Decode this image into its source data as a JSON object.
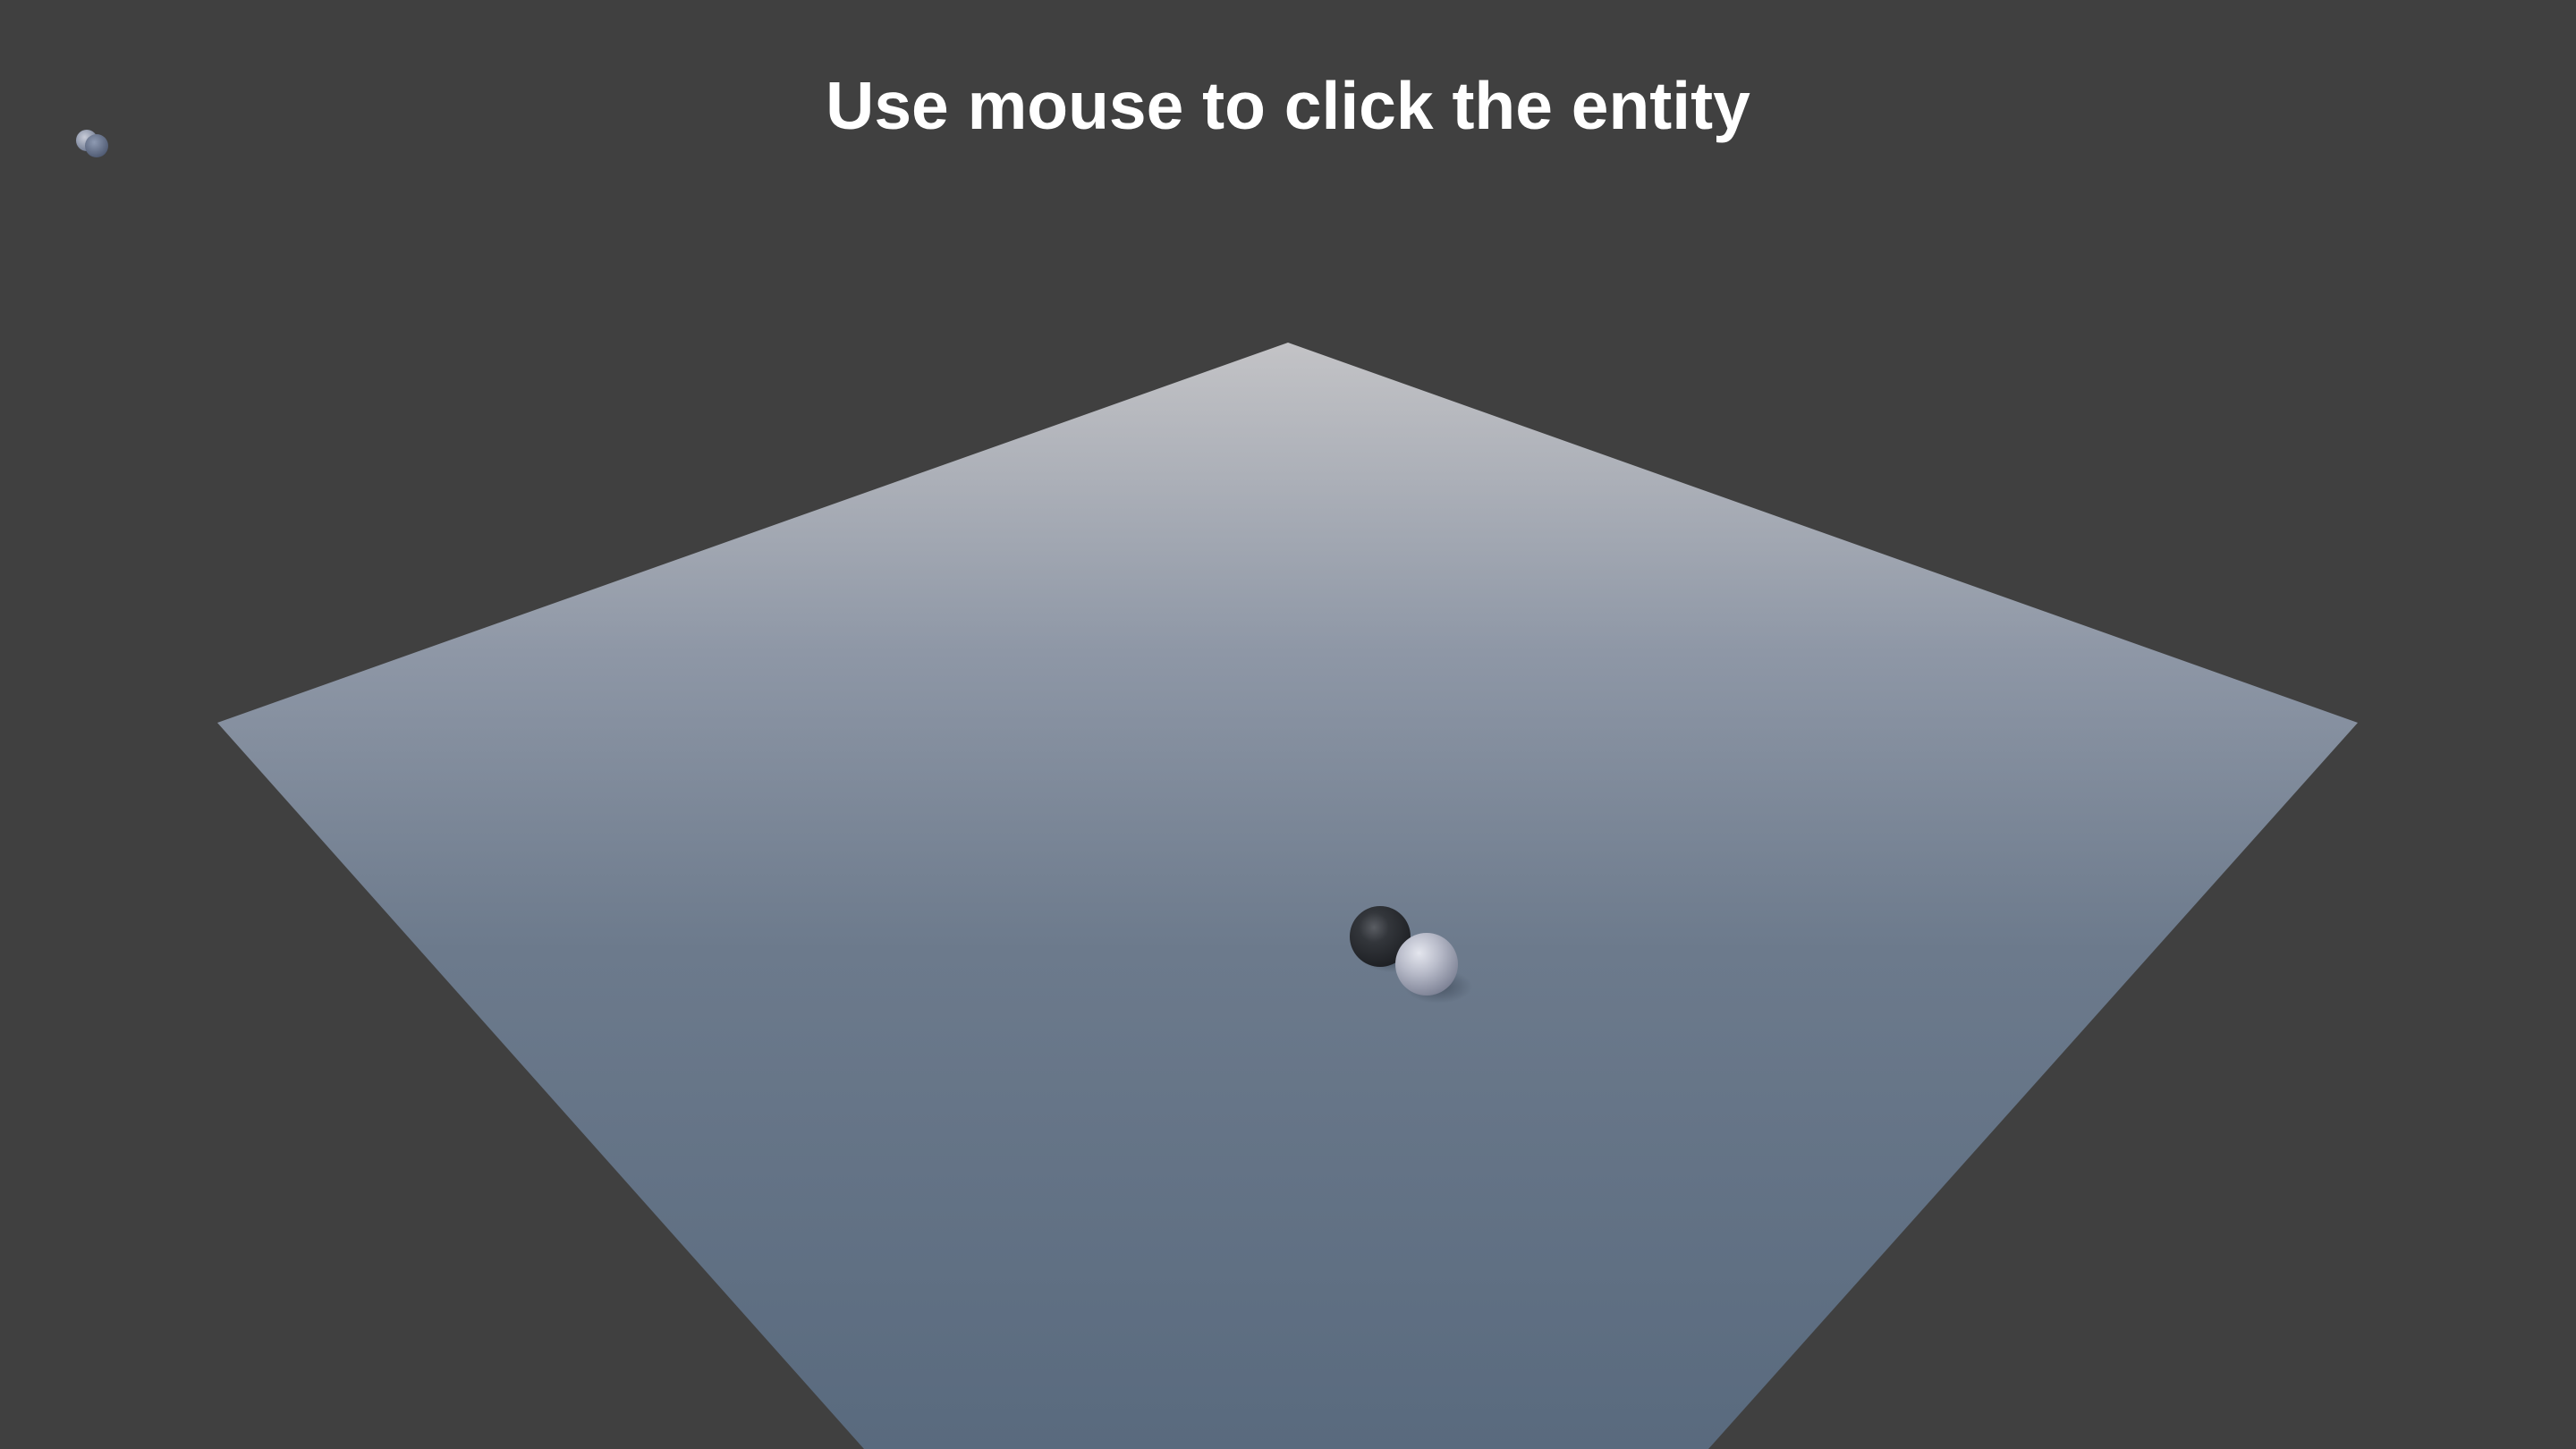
{
  "hud": {
    "instruction": "Use mouse to click the entity"
  },
  "scene": {
    "background_color": "#404040",
    "ground_top_color": "#c3c3c6",
    "ground_mid_color": "#7a8798",
    "ground_bottom_color": "#596a7e",
    "entities": [
      {
        "name": "dark-sphere",
        "color": "#2b2e33"
      },
      {
        "name": "light-sphere",
        "color": "#b9bcca"
      }
    ],
    "corner_indicator": {
      "icon": "spheres-icon",
      "color": "#7f8aa3"
    }
  }
}
